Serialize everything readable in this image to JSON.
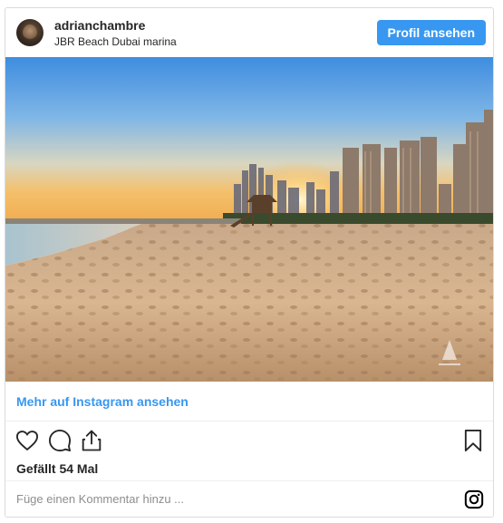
{
  "header": {
    "username": "adrianchambre",
    "location": "JBR Beach Dubai marina",
    "profile_button_label": "Profil ansehen"
  },
  "post": {
    "image_description": "JBR beach sunset",
    "more_link_label": "Mehr auf Instagram ansehen",
    "likes_text": "Gefällt 54 Mal"
  },
  "actions": {
    "icons": [
      "heart-icon",
      "comment-icon",
      "share-icon",
      "bookmark-icon"
    ]
  },
  "comment": {
    "placeholder": "Füge einen Kommentar hinzu ..."
  },
  "footer": {
    "icon": "instagram-icon"
  },
  "colors": {
    "accent": "#3897f0",
    "text": "#262626",
    "muted": "#8e8e8e",
    "border": "#dbdbdb"
  }
}
